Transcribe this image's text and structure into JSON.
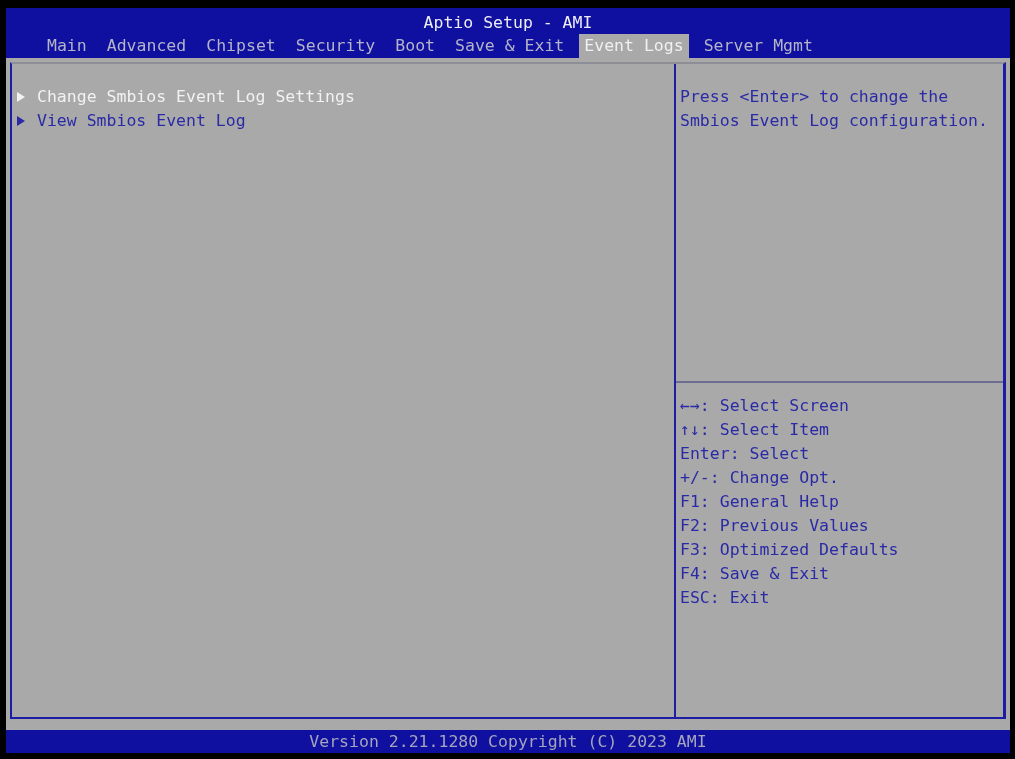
{
  "window": {
    "title": "Aptio Setup - AMI"
  },
  "tabs": [
    {
      "label": "Main",
      "selected": false
    },
    {
      "label": "Advanced",
      "selected": false
    },
    {
      "label": "Chipset",
      "selected": false
    },
    {
      "label": "Security",
      "selected": false
    },
    {
      "label": "Boot",
      "selected": false
    },
    {
      "label": "Save & Exit",
      "selected": false
    },
    {
      "label": "Event Logs",
      "selected": true
    },
    {
      "label": "Server Mgmt",
      "selected": false
    }
  ],
  "menu_items": [
    {
      "label": "Change Smbios Event Log Settings",
      "selected": true
    },
    {
      "label": "View Smbios Event Log",
      "selected": false
    }
  ],
  "help_text": "Press <Enter> to change the Smbios Event Log configuration.",
  "key_help": [
    "←→: Select Screen",
    "↑↓: Select Item",
    "Enter: Select",
    "+/-: Change Opt.",
    "F1: General Help",
    "F2: Previous Values",
    "F3: Optimized Defaults",
    "F4: Save & Exit",
    "ESC: Exit"
  ],
  "footer": "Version 2.21.1280 Copyright (C) 2023 AMI"
}
